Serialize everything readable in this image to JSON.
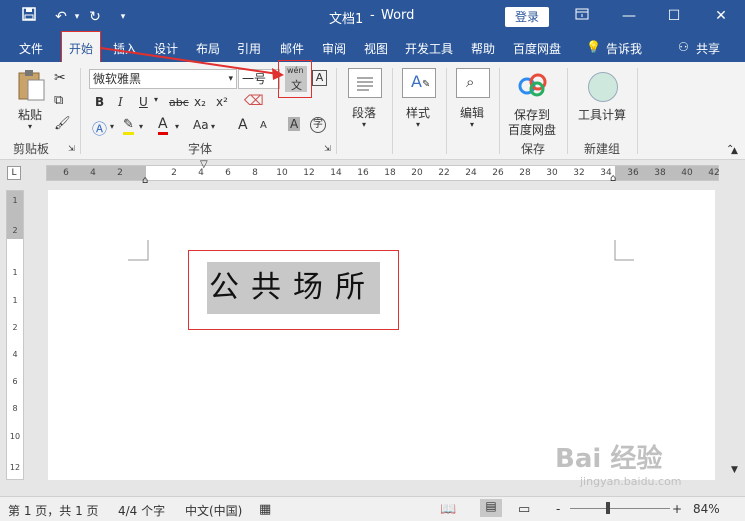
{
  "title_bar": {
    "doc_title": "文档1",
    "separator": "-",
    "app_name": "Word",
    "login_label": "登录",
    "save_icon": "save-icon",
    "undo_icon": "undo-icon",
    "redo_icon": "redo-icon",
    "customize_icon": "customize-qat-icon",
    "window_controls": [
      "ribbon-display-icon",
      "minimize-icon",
      "maximize-icon",
      "close-icon"
    ],
    "bg_color": "#2b579a"
  },
  "tabs": {
    "file": "文件",
    "home": "开始",
    "insert": "插入",
    "design": "设计",
    "layout": "布局",
    "references": "引用",
    "mailings": "邮件",
    "review": "审阅",
    "view": "视图",
    "developer": "开发工具",
    "help": "帮助",
    "baidu": "百度网盘",
    "tellme": "告诉我",
    "share": "共享"
  },
  "ribbon": {
    "clipboard": {
      "paste": "粘贴",
      "label": "剪贴板"
    },
    "font": {
      "font_name": "微软雅黑",
      "font_size": "一号",
      "bold": "B",
      "italic": "I",
      "underline": "U",
      "strike": "abc",
      "subscript": "x₂",
      "superscript": "x²",
      "change_case": "Aa",
      "grow": "A",
      "shrink": "A",
      "phonetic_top": "wén",
      "phonetic_bottom": "文",
      "char_border": "A",
      "char_shade": "A",
      "enclose": "字",
      "label": "字体"
    },
    "paragraph": {
      "label": "段落"
    },
    "styles": {
      "label": "样式"
    },
    "editing": {
      "label": "编辑"
    },
    "save_baidu": {
      "line1": "保存到",
      "line2": "百度网盘",
      "label": "保存"
    },
    "newgroup": {
      "tool": "工具计算",
      "label": "新建组"
    }
  },
  "ruler": {
    "numbers": [
      "6",
      "4",
      "2",
      "2",
      "4",
      "6",
      "8",
      "10",
      "12",
      "14",
      "16",
      "18",
      "20",
      "22",
      "24",
      "26",
      "28",
      "30",
      "32",
      "34",
      "36",
      "38",
      "40",
      "42"
    ],
    "vertical": [
      "1",
      "2",
      "1",
      "1",
      "2",
      "4",
      "6",
      "8",
      "10",
      "12"
    ]
  },
  "document": {
    "text": "公共场所"
  },
  "status_bar": {
    "page": "第 1 页，共 1 页",
    "words": "4/4 个字",
    "language": "中文(中国)",
    "zoom": "84%",
    "zoom_minus": "-",
    "zoom_plus": "+"
  },
  "watermark": {
    "text": "Bai 经验",
    "url": "jingyan.baidu.com"
  },
  "colors": {
    "accent": "#2b579a",
    "annotation_red": "#e03030"
  }
}
